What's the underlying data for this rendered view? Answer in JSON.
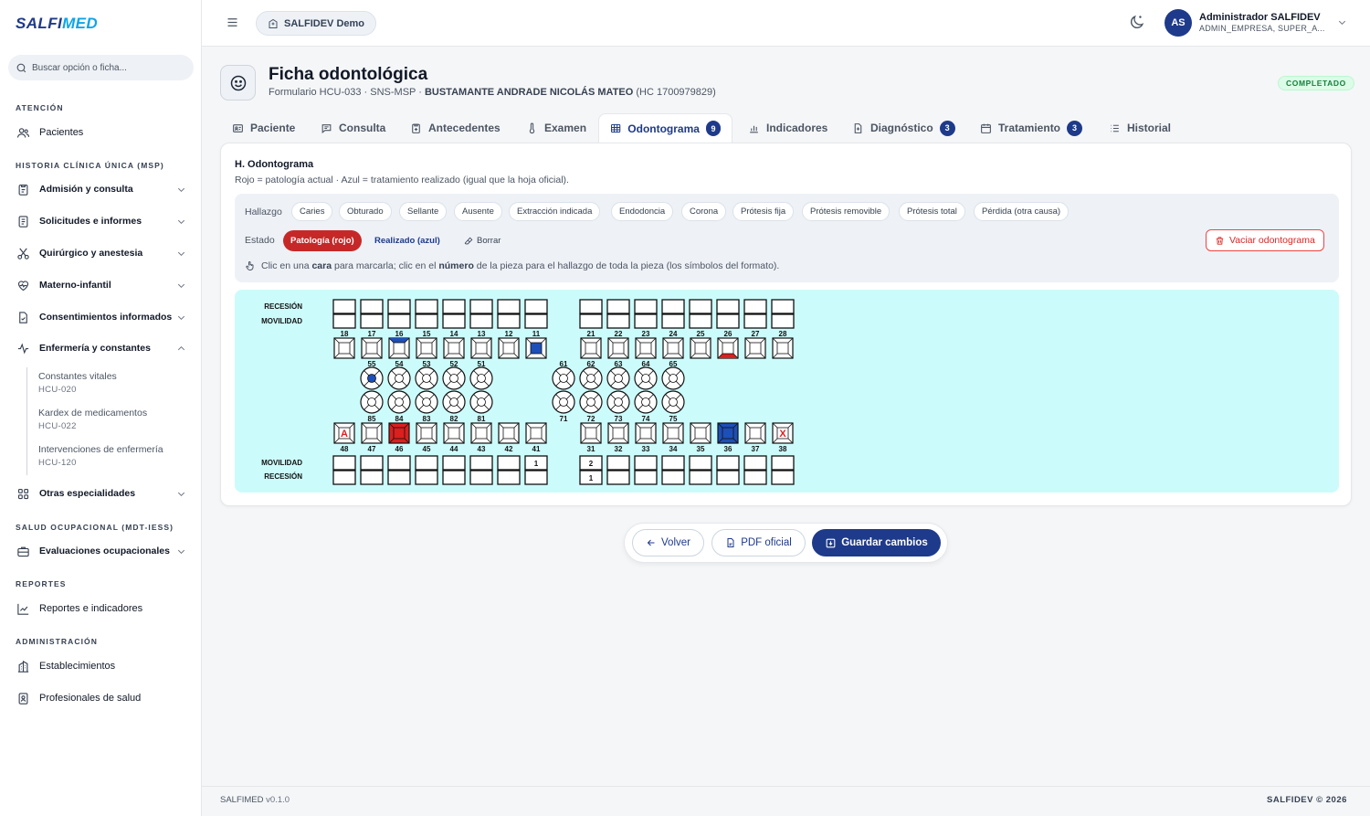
{
  "brand": {
    "logo_main": "SALFI",
    "logo_accent": "MED"
  },
  "search": {
    "placeholder": "Buscar opción o ficha..."
  },
  "sidebar": {
    "sections": [
      {
        "title": "ATENCIÓN"
      },
      {
        "title": "HISTORIA CLÍNICA ÚNICA (MSP)"
      },
      {
        "title": "SALUD OCUPACIONAL (MDT-IESS)"
      },
      {
        "title": "REPORTES"
      },
      {
        "title": "ADMINISTRACIÓN"
      }
    ],
    "items": [
      {
        "label": "Pacientes",
        "icon": "users-icon"
      },
      {
        "label": "Admisión y consulta",
        "icon": "clipboard-icon"
      },
      {
        "label": "Solicitudes e informes",
        "icon": "file-text-icon"
      },
      {
        "label": "Quirúrgico y anestesia",
        "icon": "scissors-icon"
      },
      {
        "label": "Materno-infantil",
        "icon": "heart-pulse-icon"
      },
      {
        "label": "Consentimientos informados",
        "icon": "file-check-icon"
      },
      {
        "label": "Enfermería y constantes",
        "icon": "activity-icon"
      },
      {
        "label": "Otras especialidades",
        "icon": "grid-icon"
      },
      {
        "label": "Evaluaciones ocupacionales",
        "icon": "briefcase-icon"
      },
      {
        "label": "Reportes e indicadores",
        "icon": "chart-line-icon"
      },
      {
        "label": "Establecimientos",
        "icon": "building-icon"
      },
      {
        "label": "Profesionales de salud",
        "icon": "badge-icon"
      }
    ],
    "subitems": [
      {
        "label": "Constantes vitales",
        "code": "HCU-020"
      },
      {
        "label": "Kardex de medicamentos",
        "code": "HCU-022"
      },
      {
        "label": "Intervenciones de enfermería",
        "code": "HCU-120"
      }
    ]
  },
  "topbar": {
    "tenant": "SALFIDEV Demo",
    "user_initials": "AS",
    "user_name": "Administrador SALFIDEV",
    "user_role": "ADMIN_EMPRESA, SUPER_A..."
  },
  "header": {
    "title": "Ficha odontológica",
    "subtitle_prefix": "Formulario HCU-033 · SNS-MSP · ",
    "patient": "BUSTAMANTE ANDRADE NICOLÁS MATEO",
    "hc": " (HC 1700979829)",
    "status": "COMPLETADO"
  },
  "tabs": [
    {
      "label": "Paciente",
      "icon": "id-card-icon"
    },
    {
      "label": "Consulta",
      "icon": "message-icon"
    },
    {
      "label": "Antecedentes",
      "icon": "clipboard-plus-icon"
    },
    {
      "label": "Examen",
      "icon": "thermometer-icon"
    },
    {
      "label": "Odontograma",
      "icon": "table-icon",
      "count": "9",
      "active": true
    },
    {
      "label": "Indicadores",
      "icon": "bar-chart-icon"
    },
    {
      "label": "Diagnóstico",
      "icon": "file-medical-icon",
      "count": "3"
    },
    {
      "label": "Tratamiento",
      "icon": "calendar-icon",
      "count": "3"
    },
    {
      "label": "Historial",
      "icon": "list-icon"
    }
  ],
  "section": {
    "title": "H. Odontograma",
    "subtitle": "Rojo = patología actual · Azul = tratamiento realizado (igual que la hoja oficial).",
    "hallazgo_label": "Hallazgo",
    "hallazgos": [
      "Caries",
      "Obturado",
      "Sellante",
      "Ausente",
      "Extracción indicada",
      "Endodoncia",
      "Corona",
      "Prótesis fija",
      "Prótesis removible",
      "Prótesis total",
      "Pérdida (otra causa)"
    ],
    "estado_label": "Estado",
    "estados": [
      "Patología (rojo)",
      "Realizado (azul)",
      "Borrar"
    ],
    "vaciar": "Vaciar odontograma",
    "hint_pre": "Clic en una ",
    "hint_b1": "cara",
    "hint_mid": " para marcarla; clic en el ",
    "hint_b2": "número",
    "hint_post": " de la pieza para el hallazgo de toda la pieza (los símbolos del formato)."
  },
  "odontogram": {
    "labels": {
      "recesion": "RECESIÓN",
      "movilidad": "MOVILIDAD"
    },
    "colors": {
      "pathology": "#dc1f1f",
      "done": "#1d4fb8"
    },
    "upper_right": [
      "18",
      "17",
      "16",
      "15",
      "14",
      "13",
      "12",
      "11"
    ],
    "upper_left": [
      "21",
      "22",
      "23",
      "24",
      "25",
      "26",
      "27",
      "28"
    ],
    "lower_right": [
      "48",
      "47",
      "46",
      "45",
      "44",
      "43",
      "42",
      "41"
    ],
    "lower_left": [
      "31",
      "32",
      "33",
      "34",
      "35",
      "36",
      "37",
      "38"
    ],
    "primary_upper_right": [
      "55",
      "54",
      "53",
      "52",
      "51"
    ],
    "primary_upper_left": [
      "61",
      "62",
      "63",
      "64",
      "65"
    ],
    "primary_lower_right": [
      "85",
      "84",
      "83",
      "82",
      "81"
    ],
    "primary_lower_left": [
      "71",
      "72",
      "73",
      "74",
      "75"
    ],
    "upper_values": {
      "11": {
        "rec": "",
        "mov": ""
      }
    },
    "lower_values": {
      "41": {
        "mov": "1",
        "rec": ""
      },
      "31": {
        "mov": "2",
        "rec": "1"
      }
    },
    "marks": {
      "16": {
        "face": "top",
        "color": "done"
      },
      "11": {
        "face": "center",
        "color": "done"
      },
      "26": {
        "face": "bottom",
        "color": "pathology"
      },
      "55": {
        "face": "center",
        "color": "done"
      },
      "46": {
        "face": "full",
        "color": "pathology"
      },
      "36": {
        "face": "full",
        "color": "done"
      },
      "48": {
        "symbol": "A",
        "color": "pathology"
      },
      "38": {
        "symbol": "X",
        "color": "pathology"
      }
    }
  },
  "actions": {
    "back": "Volver",
    "pdf": "PDF oficial",
    "save": "Guardar cambios"
  },
  "footer": {
    "app": "SALFIMED",
    "version": "v0.1.0",
    "copyright": "SALFIDEV © 2026"
  }
}
